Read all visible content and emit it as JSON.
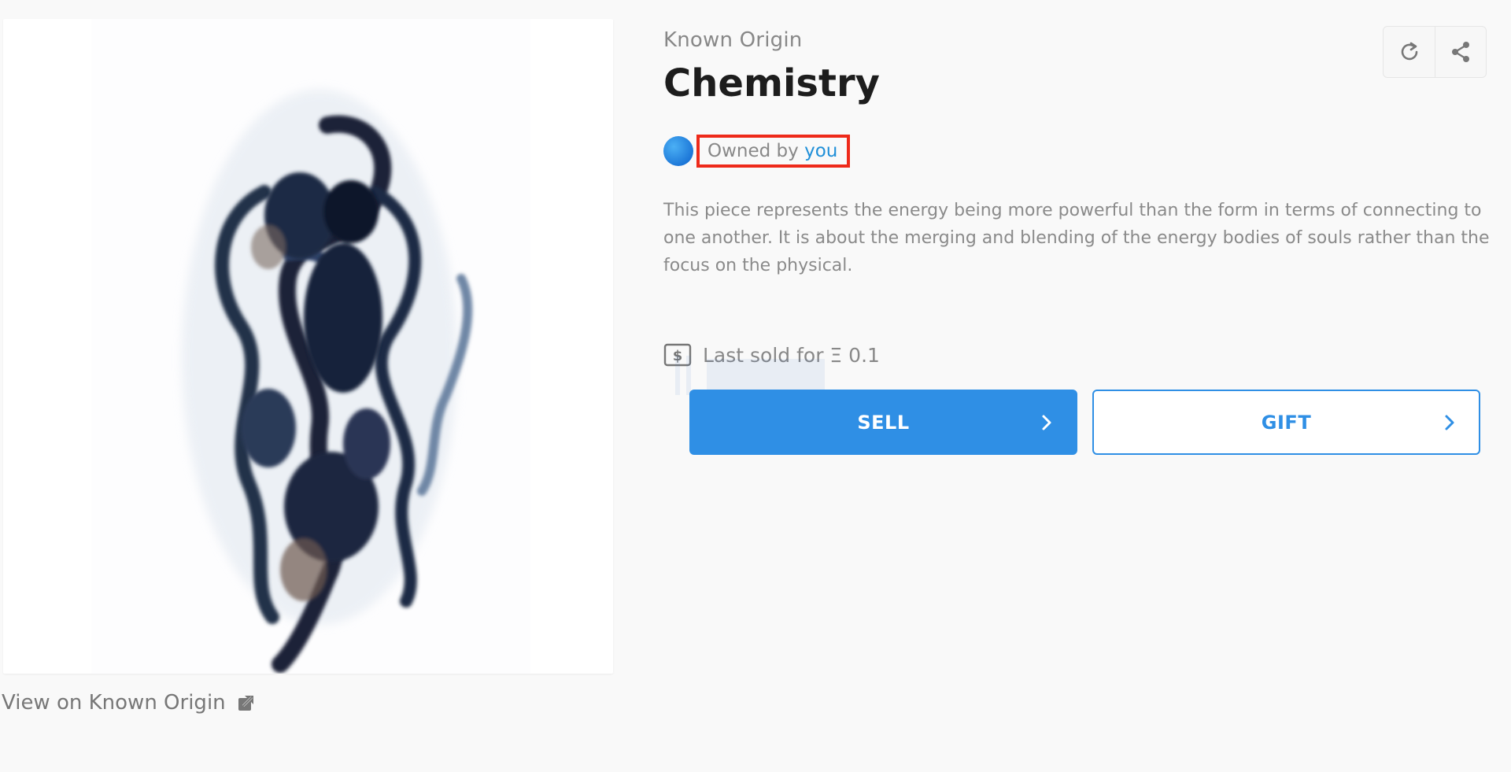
{
  "artwork": {
    "name": "Chemistry",
    "collection": "Known Origin",
    "view_link_label": "View on Known Origin"
  },
  "owner": {
    "prefix": "Owned by",
    "name": "you"
  },
  "description": "This piece represents the energy being more powerful than the form in terms of connecting to one another. It is about the merging and blending of the energy bodies of souls rather than the focus on the physical.",
  "last_sold": "Last sold for Ξ 0.1",
  "actions": {
    "sell_label": "SELL",
    "gift_label": "GIFT"
  },
  "toolbar": {
    "refresh_icon": "refresh-icon",
    "share_icon": "share-icon"
  },
  "colors": {
    "accent": "#2f8fe5",
    "highlight_box": "#ee2a1a"
  }
}
